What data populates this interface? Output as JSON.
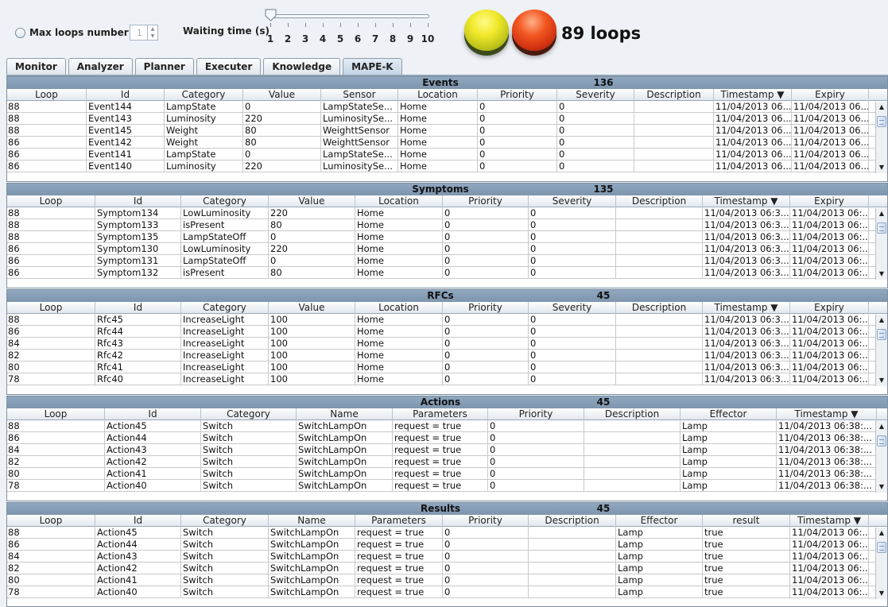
{
  "controls": {
    "max_loops_label": "Max loops number:",
    "max_loops_value": "1",
    "waiting_label": "Waiting time (s)",
    "waiting_ticks": [
      "1",
      "2",
      "3",
      "4",
      "5",
      "6",
      "7",
      "8",
      "9",
      "10"
    ],
    "waiting_value": 1,
    "loops_text": "89 loops"
  },
  "tabs": [
    "Monitor",
    "Analyzer",
    "Planner",
    "Executer",
    "Knowledge",
    "MAPE-K"
  ],
  "active_tab": "MAPE-K",
  "events": {
    "title": "Events",
    "count": "136",
    "columns": [
      "Loop",
      "Id",
      "Category",
      "Value",
      "Sensor",
      "Location",
      "Priority",
      "Severity",
      "Description",
      "Timestamp ▼",
      "Expiry"
    ],
    "rows": [
      [
        "88",
        "Event144",
        "LampState",
        "0",
        "LampStateSe...",
        "Home",
        "0",
        "0",
        "",
        "11/04/2013 06...",
        "11/04/2013 06..."
      ],
      [
        "88",
        "Event143",
        "Luminosity",
        "220",
        "LuminositySe...",
        "Home",
        "0",
        "0",
        "",
        "11/04/2013 06...",
        "11/04/2013 06..."
      ],
      [
        "88",
        "Event145",
        "Weight",
        "80",
        "WeighttSensor",
        "Home",
        "0",
        "0",
        "",
        "11/04/2013 06...",
        "11/04/2013 06..."
      ],
      [
        "86",
        "Event142",
        "Weight",
        "80",
        "WeighttSensor",
        "Home",
        "0",
        "0",
        "",
        "11/04/2013 06...",
        "11/04/2013 06..."
      ],
      [
        "86",
        "Event141",
        "LampState",
        "0",
        "LampStateSe...",
        "Home",
        "0",
        "0",
        "",
        "11/04/2013 06...",
        "11/04/2013 06..."
      ],
      [
        "86",
        "Event140",
        "Luminosity",
        "220",
        "LuminositySe...",
        "Home",
        "0",
        "0",
        "",
        "11/04/2013 06...",
        "11/04/2013 06..."
      ]
    ]
  },
  "symptoms": {
    "title": "Symptoms",
    "count": "135",
    "columns": [
      "Loop",
      "Id",
      "Category",
      "Value",
      "Location",
      "Priority",
      "Severity",
      "Description",
      "Timestamp ▼",
      "Expiry"
    ],
    "rows": [
      [
        "88",
        "Symptom134",
        "LowLuminosity",
        "220",
        "Home",
        "0",
        "0",
        "",
        "11/04/2013 06:3...",
        "11/04/2013 06:..."
      ],
      [
        "88",
        "Symptom133",
        "isPresent",
        "80",
        "Home",
        "0",
        "0",
        "",
        "11/04/2013 06:3...",
        "11/04/2013 06:..."
      ],
      [
        "88",
        "Symptom135",
        "LampStateOff",
        "0",
        "Home",
        "0",
        "0",
        "",
        "11/04/2013 06:3...",
        "11/04/2013 06:..."
      ],
      [
        "86",
        "Symptom130",
        "LowLuminosity",
        "220",
        "Home",
        "0",
        "0",
        "",
        "11/04/2013 06:3...",
        "11/04/2013 06:..."
      ],
      [
        "86",
        "Symptom131",
        "LampStateOff",
        "0",
        "Home",
        "0",
        "0",
        "",
        "11/04/2013 06:3...",
        "11/04/2013 06:..."
      ],
      [
        "86",
        "Symptom132",
        "isPresent",
        "80",
        "Home",
        "0",
        "0",
        "",
        "11/04/2013 06:3...",
        "11/04/2013 06:..."
      ]
    ]
  },
  "rfcs": {
    "title": "RFCs",
    "count": "45",
    "columns": [
      "Loop",
      "Id",
      "Category",
      "Value",
      "Location",
      "Priority",
      "Severity",
      "Description",
      "Timestamp ▼",
      "Expiry"
    ],
    "rows": [
      [
        "88",
        "Rfc45",
        "IncreaseLight",
        "100",
        "Home",
        "0",
        "0",
        "",
        "11/04/2013 06:3...",
        "11/04/2013 06:..."
      ],
      [
        "86",
        "Rfc44",
        "IncreaseLight",
        "100",
        "Home",
        "0",
        "0",
        "",
        "11/04/2013 06:3...",
        "11/04/2013 06:..."
      ],
      [
        "84",
        "Rfc43",
        "IncreaseLight",
        "100",
        "Home",
        "0",
        "0",
        "",
        "11/04/2013 06:3...",
        "11/04/2013 06:..."
      ],
      [
        "82",
        "Rfc42",
        "IncreaseLight",
        "100",
        "Home",
        "0",
        "0",
        "",
        "11/04/2013 06:3...",
        "11/04/2013 06:..."
      ],
      [
        "80",
        "Rfc41",
        "IncreaseLight",
        "100",
        "Home",
        "0",
        "0",
        "",
        "11/04/2013 06:3...",
        "11/04/2013 06:..."
      ],
      [
        "78",
        "Rfc40",
        "IncreaseLight",
        "100",
        "Home",
        "0",
        "0",
        "",
        "11/04/2013 06:3...",
        "11/04/2013 06:..."
      ]
    ]
  },
  "actions": {
    "title": "Actions",
    "count": "45",
    "columns": [
      "Loop",
      "Id",
      "Category",
      "Name",
      "Parameters",
      "Priority",
      "Description",
      "Effector",
      "Timestamp ▼"
    ],
    "rows": [
      [
        "88",
        "Action45",
        "Switch",
        "SwitchLampOn",
        "request = true",
        "0",
        "",
        "Lamp",
        "11/04/2013 06:38:..."
      ],
      [
        "86",
        "Action44",
        "Switch",
        "SwitchLampOn",
        "request = true",
        "0",
        "",
        "Lamp",
        "11/04/2013 06:38:..."
      ],
      [
        "84",
        "Action43",
        "Switch",
        "SwitchLampOn",
        "request = true",
        "0",
        "",
        "Lamp",
        "11/04/2013 06:38:..."
      ],
      [
        "82",
        "Action42",
        "Switch",
        "SwitchLampOn",
        "request = true",
        "0",
        "",
        "Lamp",
        "11/04/2013 06:38:..."
      ],
      [
        "80",
        "Action41",
        "Switch",
        "SwitchLampOn",
        "request = true",
        "0",
        "",
        "Lamp",
        "11/04/2013 06:38:..."
      ],
      [
        "78",
        "Action40",
        "Switch",
        "SwitchLampOn",
        "request = true",
        "0",
        "",
        "Lamp",
        "11/04/2013 06:38:..."
      ]
    ]
  },
  "results": {
    "title": "Results",
    "count": "45",
    "columns": [
      "Loop",
      "Id",
      "Category",
      "Name",
      "Parameters",
      "Priority",
      "Description",
      "Effector",
      "result",
      "Timestamp ▼"
    ],
    "rows": [
      [
        "88",
        "Action45",
        "Switch",
        "SwitchLampOn",
        "request = true",
        "0",
        "",
        "Lamp",
        "true",
        "11/04/2013 06:..."
      ],
      [
        "86",
        "Action44",
        "Switch",
        "SwitchLampOn",
        "request = true",
        "0",
        "",
        "Lamp",
        "true",
        "11/04/2013 06:..."
      ],
      [
        "84",
        "Action43",
        "Switch",
        "SwitchLampOn",
        "request = true",
        "0",
        "",
        "Lamp",
        "true",
        "11/04/2013 06:..."
      ],
      [
        "82",
        "Action42",
        "Switch",
        "SwitchLampOn",
        "request = true",
        "0",
        "",
        "Lamp",
        "true",
        "11/04/2013 06:..."
      ],
      [
        "80",
        "Action41",
        "Switch",
        "SwitchLampOn",
        "request = true",
        "0",
        "",
        "Lamp",
        "true",
        "11/04/2013 06:..."
      ],
      [
        "78",
        "Action40",
        "Switch",
        "SwitchLampOn",
        "request = true",
        "0",
        "",
        "Lamp",
        "true",
        "11/04/2013 06:..."
      ]
    ]
  },
  "colors": {
    "title_bar": "#8fa7c0",
    "button_yellow": "#f1e92b",
    "button_red": "#f35a24"
  }
}
